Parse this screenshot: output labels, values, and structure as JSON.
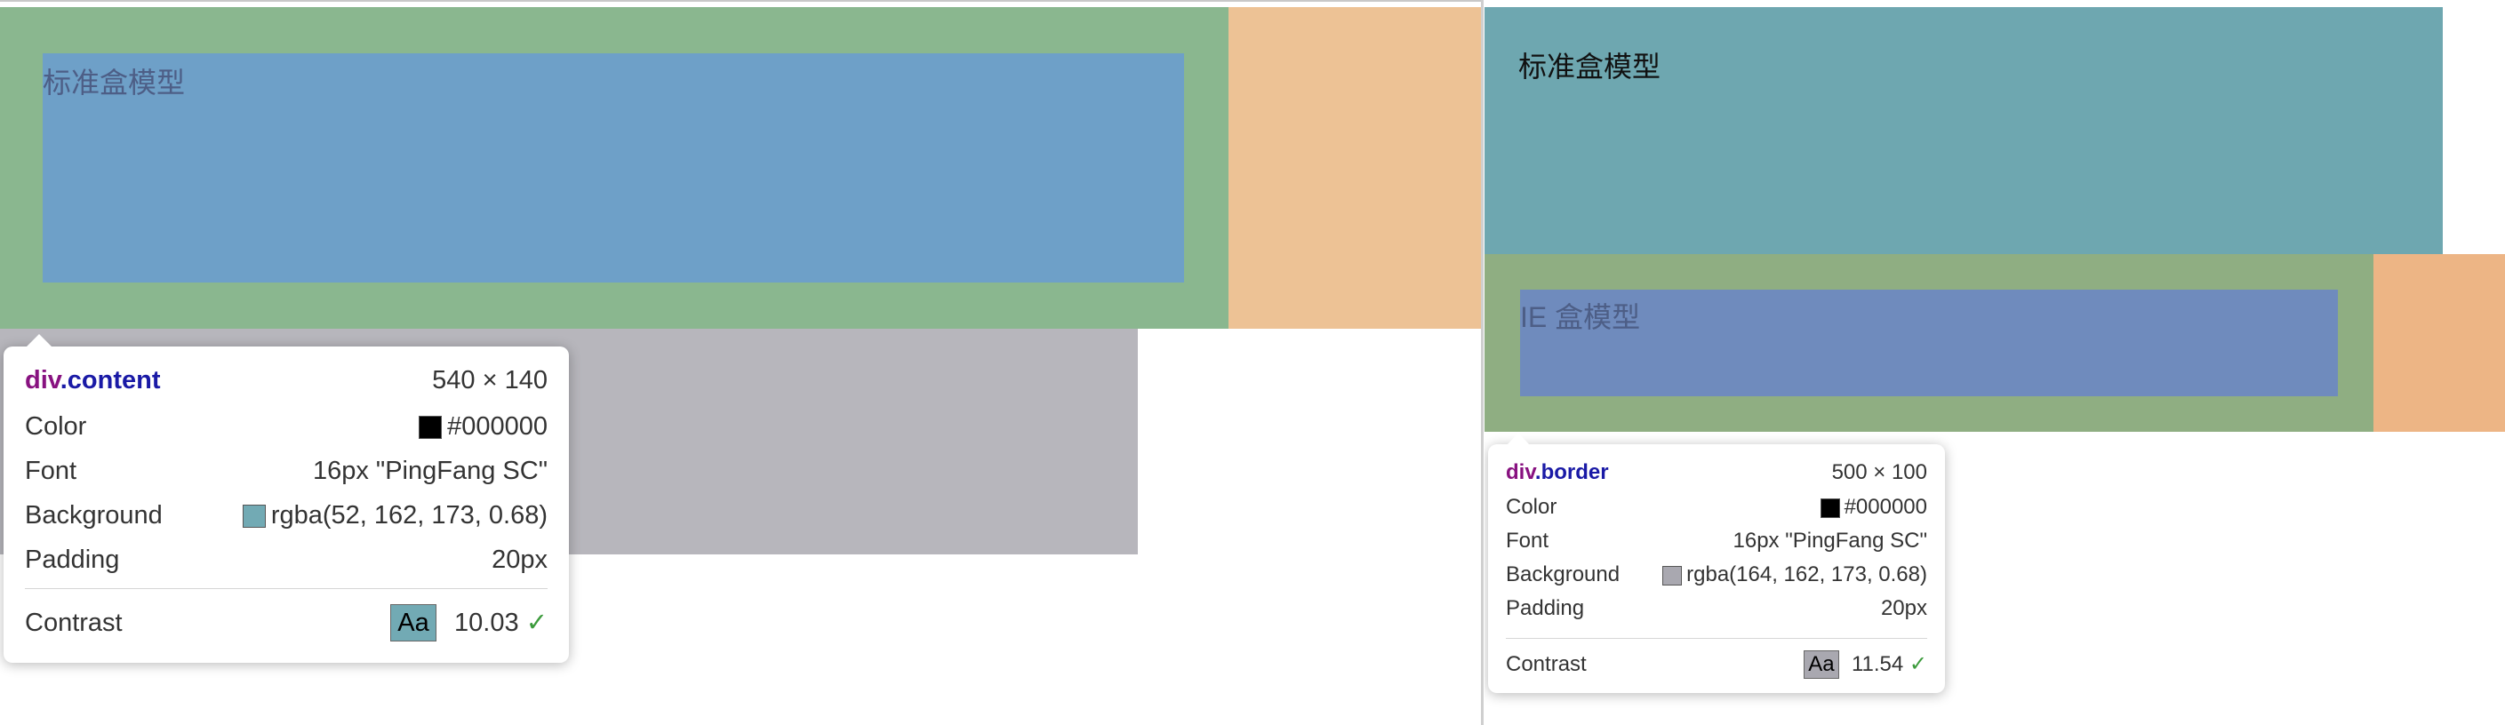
{
  "left": {
    "box_label": "标准盒模型",
    "colors": {
      "margin": "#edc295",
      "border": "#8ab78f",
      "padding": "#8ab78f",
      "content": "#6ea0c8",
      "sibling": "#b7b6bc"
    },
    "tooltip": {
      "tag": "div",
      "class": ".content",
      "size": "540 × 140",
      "rows": [
        {
          "label": "Color",
          "value": "#000000",
          "swatch": "#000000"
        },
        {
          "label": "Font",
          "value": "16px \"PingFang SC\""
        },
        {
          "label": "Background",
          "value": "rgba(52, 162, 173, 0.68)",
          "swatch": "#72aab4"
        },
        {
          "label": "Padding",
          "value": "20px"
        }
      ],
      "contrast_label": "Contrast",
      "contrast_sample": "Aa",
      "contrast_sample_bg": "#72aab4",
      "contrast_value": "10.03"
    }
  },
  "right": {
    "top_box_label": "标准盒模型",
    "box_label": "IE 盒模型",
    "colors": {
      "top_box": "#6ea7b0",
      "margin": "#edb585",
      "border": "#8fae82",
      "content": "#6f8bbd"
    },
    "tooltip": {
      "tag": "div",
      "class": ".border",
      "size": "500 × 100",
      "rows": [
        {
          "label": "Color",
          "value": "#000000",
          "swatch": "#000000"
        },
        {
          "label": "Font",
          "value": "16px \"PingFang SC\""
        },
        {
          "label": "Background",
          "value": "rgba(164, 162, 173, 0.68)",
          "swatch": "#a9a8b0"
        },
        {
          "label": "Padding",
          "value": "20px"
        }
      ],
      "contrast_label": "Contrast",
      "contrast_sample": "Aa",
      "contrast_sample_bg": "#a9a8b0",
      "contrast_value": "11.54"
    }
  }
}
